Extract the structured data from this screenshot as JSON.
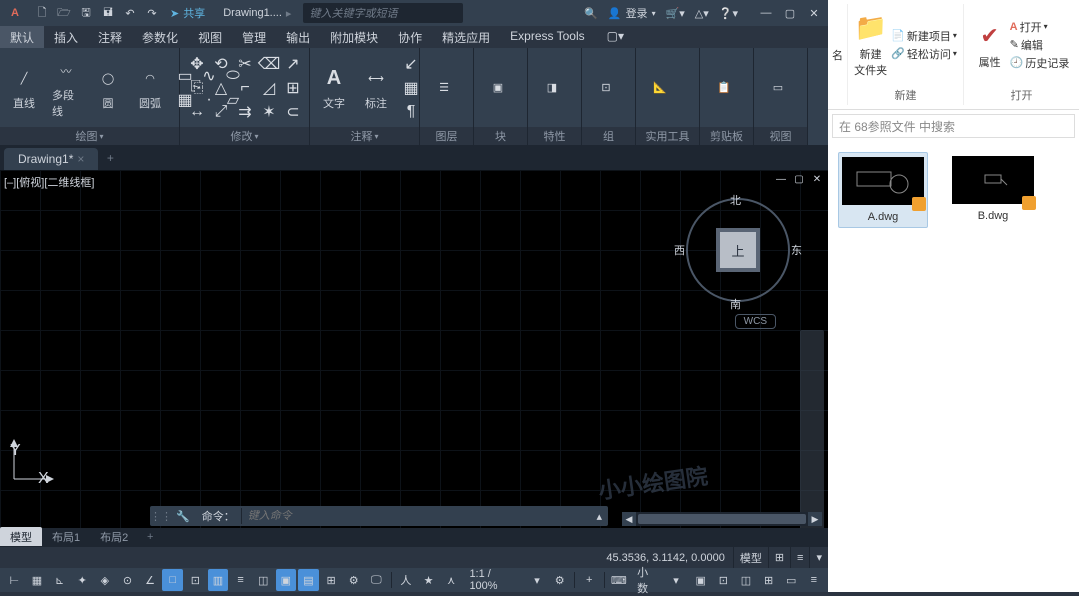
{
  "titlebar": {
    "logo": "A",
    "share_label": "共享",
    "docname": "Drawing1....",
    "search_placeholder": "键入关键字或短语",
    "login_label": "登录"
  },
  "ribtabs": [
    "默认",
    "插入",
    "注释",
    "参数化",
    "视图",
    "管理",
    "输出",
    "附加模块",
    "协作",
    "精选应用",
    "Express Tools"
  ],
  "ribbon": {
    "draw": {
      "title": "绘图",
      "btns": [
        "直线",
        "多段线",
        "圆",
        "圆弧"
      ]
    },
    "modify": {
      "title": "修改"
    },
    "annotate": {
      "title": "注释",
      "btns": [
        "文字",
        "标注"
      ]
    },
    "layer": {
      "title": "图层"
    },
    "block": {
      "title": "块"
    },
    "props": {
      "title": "特性"
    },
    "group": {
      "title": "组"
    },
    "utils": {
      "title": "实用工具"
    },
    "clipboard": {
      "title": "剪贴板"
    },
    "view": {
      "title": "视图"
    }
  },
  "filetab": {
    "name": "Drawing1*",
    "close": "×"
  },
  "drawing": {
    "viewlabel": "[–][俯视][二维线框]",
    "cube": {
      "top": "上",
      "n": "北",
      "s": "南",
      "e": "东",
      "w": "西"
    },
    "wcs": "WCS",
    "watermark": "小小绘图院",
    "cmd_label": "命令：",
    "cmd_placeholder": "键入命令",
    "ucs": {
      "x": "X",
      "y": "Y"
    }
  },
  "layouttabs": [
    "模型",
    "布局1",
    "布局2"
  ],
  "status": {
    "coords": "45.3536, 3.1142, 0.0000",
    "model": "模型",
    "zoom": "1:1 / 100%",
    "units": "小数"
  },
  "explorer": {
    "qty": "名",
    "new_group": {
      "title": "新建",
      "big": "新建\n文件夹",
      "items": [
        "新建项目",
        "轻松访问"
      ]
    },
    "open_group": {
      "title": "打开",
      "big": "属性",
      "items": [
        "打开",
        "编辑",
        "历史记录"
      ]
    },
    "search": "在 68参照文件 中搜索",
    "files": [
      {
        "name": "A.dwg"
      },
      {
        "name": "B.dwg"
      }
    ]
  }
}
